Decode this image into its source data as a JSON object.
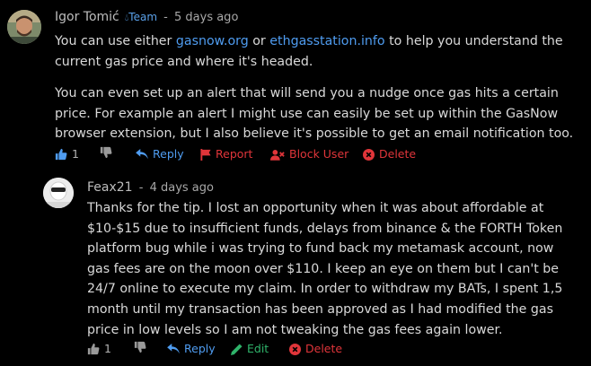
{
  "comments": [
    {
      "author": "Igor Tomić",
      "badge": "Team",
      "separator": "-",
      "time": "5 days ago",
      "body": {
        "p1_before": "You can use either ",
        "link1": "gasnow.org",
        "p1_middle": " or ",
        "link2": "ethgasstation.info",
        "p1_after": " to help you understand the current gas price and where it's headed.",
        "p2": "You can even set up an alert that will send you a nudge once gas hits a certain price. For example an alert I might use can easily be set up within the GasNow browser extension, but I also believe it's possible to get an email notification too."
      },
      "actions": {
        "like_count": "1",
        "reply": "Reply",
        "report": "Report",
        "block_user": "Block User",
        "delete": "Delete"
      }
    },
    {
      "author": "Feax21",
      "separator": "-",
      "time": "4 days ago",
      "body": "Thanks for the tip. I lost an opportunity when it was about affordable at $10-$15 due to insufficient funds, delays from binance & the FORTH Token platform bug while i was trying to fund back my metamask account, now gas fees are on the moon over $110. I keep an eye on them but I can't be 24/7 online to execute my claim. In order to withdraw my BATs, I spent 1,5 month until my transaction has been approved as I had modified the gas price in low levels so I am not tweaking the gas fees again lower.",
      "actions": {
        "like_count": "1",
        "reply": "Reply",
        "edit": "Edit",
        "delete": "Delete"
      }
    }
  ],
  "colors": {
    "background": "#000000",
    "text": "#d9d9d9",
    "link": "#4f9cf0",
    "danger": "#e0353a",
    "edit": "#2fb36a",
    "muted": "#a8a8a8"
  },
  "icons": {
    "like": "thumbs-up-icon",
    "dislike": "thumbs-down-icon",
    "reply": "reply-arrow-icon",
    "report": "flag-icon",
    "block": "user-block-icon",
    "delete": "circle-x-icon",
    "edit": "pencil-icon",
    "team": "droplet-icon"
  }
}
